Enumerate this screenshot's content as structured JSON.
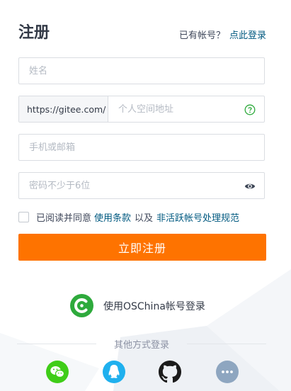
{
  "header": {
    "title": "注册",
    "have_account": "已有帐号？",
    "login_link": "点此登录"
  },
  "form": {
    "name_placeholder": "姓名",
    "space_prefix": "https://gitee.com/",
    "space_placeholder": "个人空间地址",
    "phone_placeholder": "手机或邮箱",
    "password_placeholder": "密码不少于6位",
    "agree_text": "已阅读并同意",
    "terms_link": "使用条款",
    "and_text": "以及",
    "inactive_link": "非活跃帐号处理规范",
    "submit_label": "立即注册"
  },
  "oschina": {
    "label": "使用OSChina帐号登录",
    "icon": "oschina-logo-icon",
    "color": "#2eaa3c"
  },
  "other_login": {
    "label": "其他方式登录",
    "providers": [
      {
        "name": "wechat",
        "icon": "wechat-icon",
        "color": "#3fcd18"
      },
      {
        "name": "qq",
        "icon": "qq-icon",
        "color": "#1fb0ee"
      },
      {
        "name": "github",
        "icon": "github-icon",
        "color": "#1c1c1c"
      },
      {
        "name": "more",
        "icon": "more-icon",
        "color": "#8ea6c0"
      }
    ]
  },
  "colors": {
    "accent": "#fe7300",
    "link": "#005980"
  }
}
